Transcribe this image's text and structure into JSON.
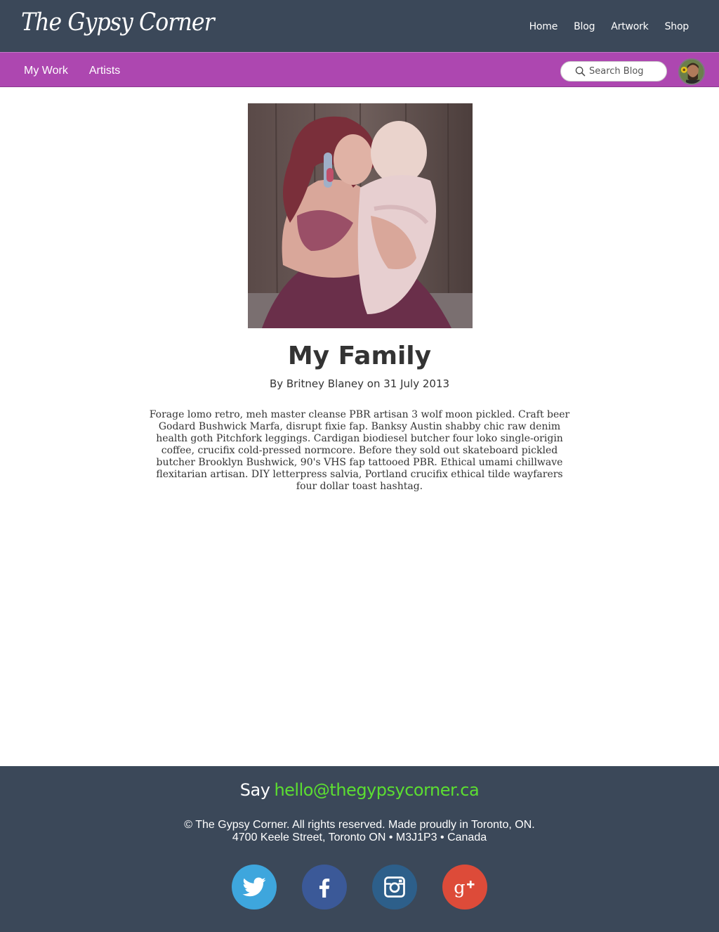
{
  "header": {
    "logo": "The Gypsy Corner",
    "nav": [
      "Home",
      "Blog",
      "Artwork",
      "Shop"
    ]
  },
  "subnav": {
    "items": [
      "My Work",
      "Artists"
    ],
    "search_placeholder": "Search Blog"
  },
  "post": {
    "title": "My Family",
    "byline": "By Britney Blaney on 31 July 2013",
    "body": "Forage lomo retro, meh master cleanse PBR artisan 3 wolf moon pickled. Craft beer Godard Bushwick Marfa, disrupt fixie fap. Banksy Austin shabby chic raw denim health goth Pitchfork leggings. Cardigan biodiesel butcher four loko single-origin coffee, crucifix cold-pressed normcore. Before they sold out skateboard pickled butcher Brooklyn Bushwick, 90's VHS fap tattooed PBR. Ethical umami chillwave flexitarian artisan. DIY letterpress salvia, Portland crucifix ethical tilde wayfarers four dollar toast hashtag."
  },
  "footer": {
    "say": "Say",
    "email": "hello@thegypsycorner.ca",
    "copyright": "© The Gypsy Corner. All rights reserved. Made proudly in Toronto, ON.",
    "address": "4700 Keele Street, Toronto ON • M3J1P3 • Canada",
    "social": [
      {
        "icon": "twitter-icon",
        "color": "#3ea6dd"
      },
      {
        "icon": "facebook-icon",
        "color": "#3b5998"
      },
      {
        "icon": "instagram-icon",
        "color": "#2d5f8a"
      },
      {
        "icon": "google-plus-icon",
        "color": "#dd4b39"
      }
    ]
  },
  "colors": {
    "header_bg": "#3b4859",
    "subnav_bg": "#ad47b0",
    "email_green": "#5cde31"
  }
}
